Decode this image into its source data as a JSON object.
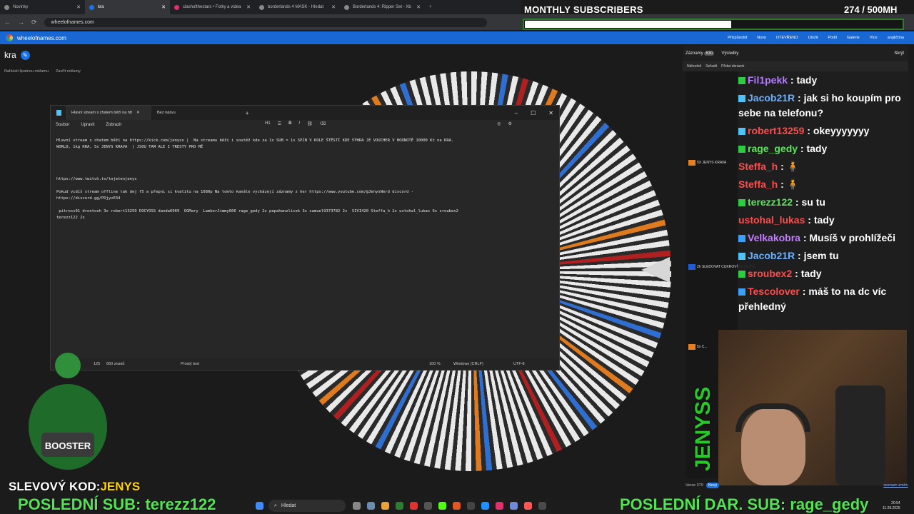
{
  "browser": {
    "tabs": [
      {
        "label": "Novinky"
      },
      {
        "label": "kra"
      },
      {
        "label": "clashofthestars • Fotky a videa"
      },
      {
        "label": "borderlands 4 MASK - Hledat"
      },
      {
        "label": "Borderlands 4: Ripper Set - Xb"
      }
    ],
    "new_tab": "+",
    "url": "wheelofnames.com"
  },
  "site": {
    "brand": "wheelofnames.com",
    "menu": [
      "Přizpůsobit",
      "Nový",
      "OTEVŘENO",
      "Uložit",
      "Podíl",
      "Galerie",
      "Více",
      "angličtina"
    ],
    "wheel_title": "kra",
    "ad_links": [
      "Nahlásit špatnou reklamu",
      "Zavřít reklamy"
    ],
    "entries_tab": "Záznamy",
    "entries_count": "830",
    "results_tab": "Výsledky",
    "hide_label": "Skrýt",
    "sub_actions": [
      "Náhodně",
      "Seřadit",
      "Přidat obrázek"
    ],
    "side_items": [
      "5X JENYS KRAVA",
      "2h SLEDOVAT CUKROVÍ NA HLAVĚ",
      "5x C..."
    ],
    "version": "Verze 379",
    "version_badge": "Nový",
    "changes_link": "seznam změn"
  },
  "overlay": {
    "monthly_title": "MONTHLY SUBSCRIBERS",
    "monthly_count": "274  / 500MH",
    "monthly_progress": 0.548,
    "promo_label": "SLEVOVÝ KOD:",
    "promo_code": "JENYS",
    "last_sub": "POSLEDNÍ SUB: terezz122",
    "last_gift": "POSLEDNÍ DAR. SUB: rage_gedy",
    "streamer_logo": "JENYSS",
    "booster_text": "BOOSTER"
  },
  "notepad": {
    "tabs": [
      "Hlavní stream s chatem běží na htt",
      "Bez názvu"
    ],
    "menu": [
      "Soubor",
      "Upravit",
      "Zobrazit"
    ],
    "heading_tool": "H1",
    "lines": [
      "Hlavní stream s chatem běží na https://kick.com/jenyss |  Na streamu běží i soutěž kde za 1x SUB = 1x SPIN V KOLE ŠTĚSTÍ KDE VÝHRA JE VOUCHER V HODNOTĚ 10000 Kč na KRA.",
      "WORLD, 1kg KRA, 5x JENYS KRAVA  | JSOU TAM ALE I TRESTY PRO MĚ",
      "",
      "",
      "",
      "",
      "https://www.twitch.tv/tojetenjenys",
      "",
      "Pokud vidíš stream offline tak dej f5 a přepni si kvalitu na 1080p Na tomto kanále vycházejí záznamy z her https://www.youtube.com/@JenysNerd discord -",
      "https://discord.gg/PDjyvE34",
      "",
      " pitross01 drontosh 3x robert13259 DOCYOSS danda6969  OGMary  LamborJimmy666 rage_gedy 2x pepahanzlicek 3x samuel9373782 2x  SIVI420 Steffa_h 2x ustohal_lukas 6x sroubex2",
      "terezz122 2x"
    ],
    "status": {
      "pos": "125",
      "chars": "650 znaků",
      "type": "Prostý text",
      "zoom": "100 %",
      "eol": "Windows (CRLF)",
      "enc": "UTF-8"
    }
  },
  "chat": [
    {
      "user": "Fil1pekk",
      "text": " : tady",
      "color": "#b57cff",
      "badge": "#2ecc40"
    },
    {
      "user": "Jacob21R",
      "text": " : jak si ho koupím pro sebe na telefonu?",
      "color": "#6ab0ff",
      "badge": "#4fc3f7"
    },
    {
      "user": "robert13259",
      "text": " : okeyyyyyyy",
      "color": "#ff4d4d",
      "badge": "#4fc3f7"
    },
    {
      "user": "rage_gedy",
      "text": " : tady",
      "color": "#5fe35f",
      "badge": "#2ecc40"
    },
    {
      "user": "Steffa_h",
      "text": " : 🧍",
      "color": "#ff4d4d",
      "badge": ""
    },
    {
      "user": "Steffa_h",
      "text": " : 🧍",
      "color": "#ff4d4d",
      "badge": ""
    },
    {
      "user": "terezz122",
      "text": " : su tu",
      "color": "#5fe35f",
      "badge": "#2ecc40"
    },
    {
      "user": "ustohal_lukas",
      "text": " : tady",
      "color": "#ff4d4d",
      "badge": ""
    },
    {
      "user": "Velkakobra",
      "text": " : Musíš v prohlížeči",
      "color": "#c47cff",
      "badge": "#3aa0ff"
    },
    {
      "user": "Jacob21R",
      "text": " : jsem tu",
      "color": "#6ab0ff",
      "badge": "#4fc3f7"
    },
    {
      "user": "sroubex2",
      "text": " : tady",
      "color": "#ff4d4d",
      "badge": "#2ecc40"
    },
    {
      "user": "Tescolover",
      "text": " : máš to na dc víc přehledný",
      "color": "#ff4d4d",
      "badge": "#3aa0ff"
    }
  ],
  "taskbar": {
    "search": "Hledat",
    "time": "20:54",
    "date": "11.09.2025"
  },
  "icons": [
    "search-icon",
    "windows-start-icon",
    "minimize-icon",
    "maximize-icon",
    "close-icon",
    "pencil-icon",
    "pointer-arrow-icon"
  ],
  "colors": {
    "accent": "#1967d2",
    "ticker": "#53e453",
    "wheel_blue": "#2e6fd1",
    "wheel_orange": "#e07a1f"
  }
}
